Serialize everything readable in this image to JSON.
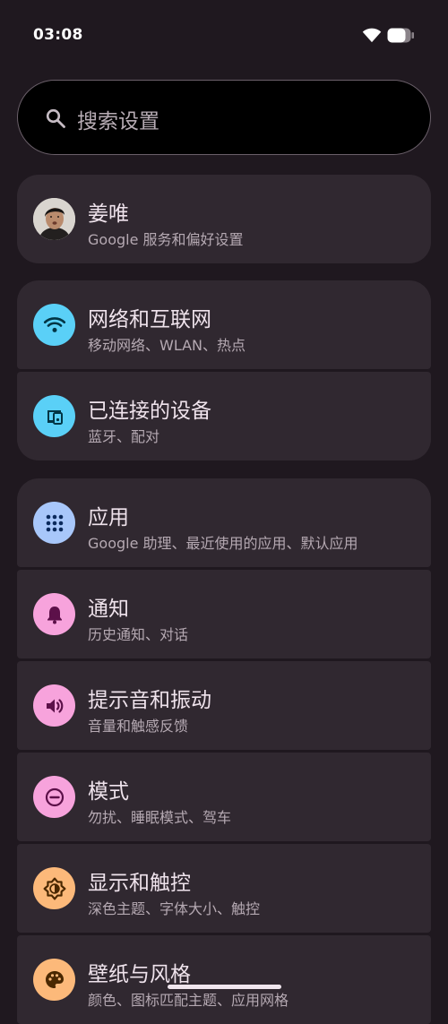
{
  "status_bar": {
    "time": "03:08",
    "wifi_icon": "wifi-icon",
    "battery_icon": "battery-icon"
  },
  "search": {
    "placeholder": "搜索设置",
    "icon": "search-icon"
  },
  "account": {
    "name": "姜唯",
    "subtitle": "Google 服务和偏好设置",
    "icon": "avatar"
  },
  "settings": [
    {
      "title": "网络和互联网",
      "subtitle": "移动网络、WLAN、热点",
      "icon": "wifi-icon",
      "icon_bg": "#5ad0f7"
    },
    {
      "title": "已连接的设备",
      "subtitle": "蓝牙、配对",
      "icon": "connected-devices-icon",
      "icon_bg": "#5ad0f7"
    },
    {
      "title": "应用",
      "subtitle": "Google 助理、最近使用的应用、默认应用",
      "icon": "apps-grid-icon",
      "icon_bg": "#a8c7fa"
    },
    {
      "title": "通知",
      "subtitle": "历史通知、对话",
      "icon": "bell-icon",
      "icon_bg": "#f7a3dc"
    },
    {
      "title": "提示音和振动",
      "subtitle": "音量和触感反馈",
      "icon": "speaker-icon",
      "icon_bg": "#f7a3dc"
    },
    {
      "title": "模式",
      "subtitle": "勿扰、睡眠模式、驾车",
      "icon": "dnd-mode-icon",
      "icon_bg": "#f7a3dc"
    },
    {
      "title": "显示和触控",
      "subtitle": "深色主题、字体大小、触控",
      "icon": "brightness-icon",
      "icon_bg": "#fcb97a"
    },
    {
      "title": "壁纸与风格",
      "subtitle": "颜色、图标匹配主题、应用网格",
      "icon": "palette-icon",
      "icon_bg": "#fcb97a"
    }
  ]
}
